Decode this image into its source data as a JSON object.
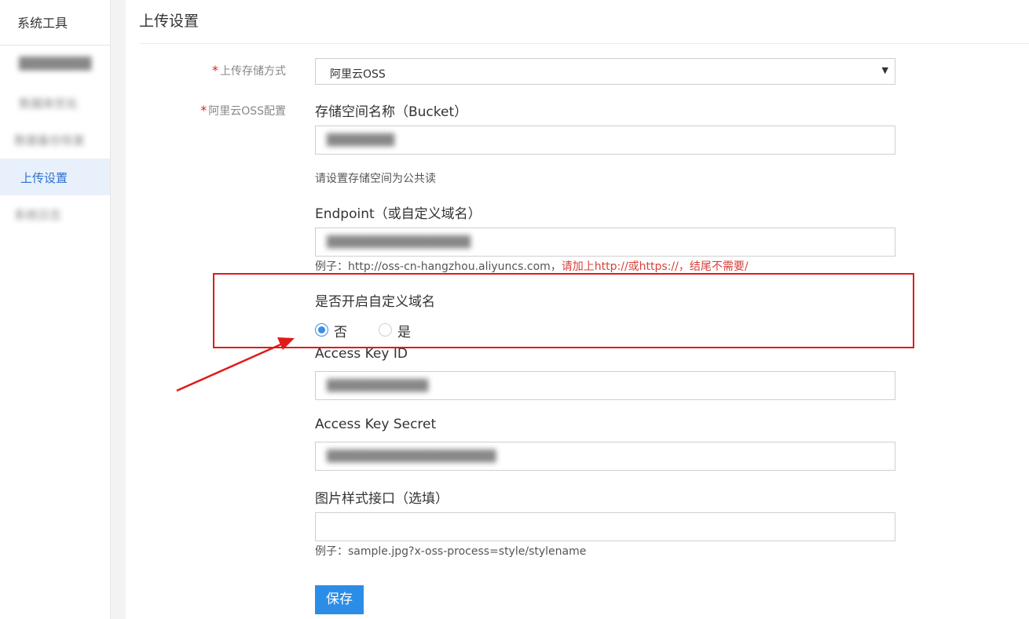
{
  "sidebar": {
    "title": "系统工具",
    "items": [
      {
        "label": "████████"
      },
      {
        "label": "数据库优化"
      },
      {
        "label": "数据备份恢复"
      },
      {
        "label": "上传设置"
      },
      {
        "label": "系统日志"
      }
    ],
    "active_index": 3
  },
  "page": {
    "title": "上传设置"
  },
  "form": {
    "storage_method_label": "上传存储方式",
    "storage_method_value": "阿里云OSS",
    "oss_config_label": "阿里云OSS配置",
    "bucket_title": "存储空间名称（Bucket）",
    "bucket_value": "████████",
    "bucket_hint": "请设置存储空间为公共读",
    "endpoint_title": "Endpoint（或自定义域名）",
    "endpoint_value": "█████████████████",
    "endpoint_hint_prefix": "例子：http://oss-cn-hangzhou.aliyuncs.com，",
    "endpoint_hint_red": "请加上http://或https://，结尾不需要/",
    "custom_domain_title": "是否开启自定义域名",
    "radio_no": "否",
    "radio_yes": "是",
    "custom_domain_selected": "否",
    "access_key_id_title": "Access Key ID",
    "access_key_id_value": "████████████",
    "access_key_secret_title": "Access Key Secret",
    "access_key_secret_value": "████████████████████",
    "image_style_title": "图片样式接口（选填）",
    "image_style_value": "",
    "image_style_hint": "例子：sample.jpg?x-oss-process=style/stylename",
    "save_label": "保存"
  },
  "colors": {
    "accent": "#2b8de6",
    "required": "#e02020",
    "annotation": "#e11a1a",
    "active_bg": "#e8f1fb"
  }
}
